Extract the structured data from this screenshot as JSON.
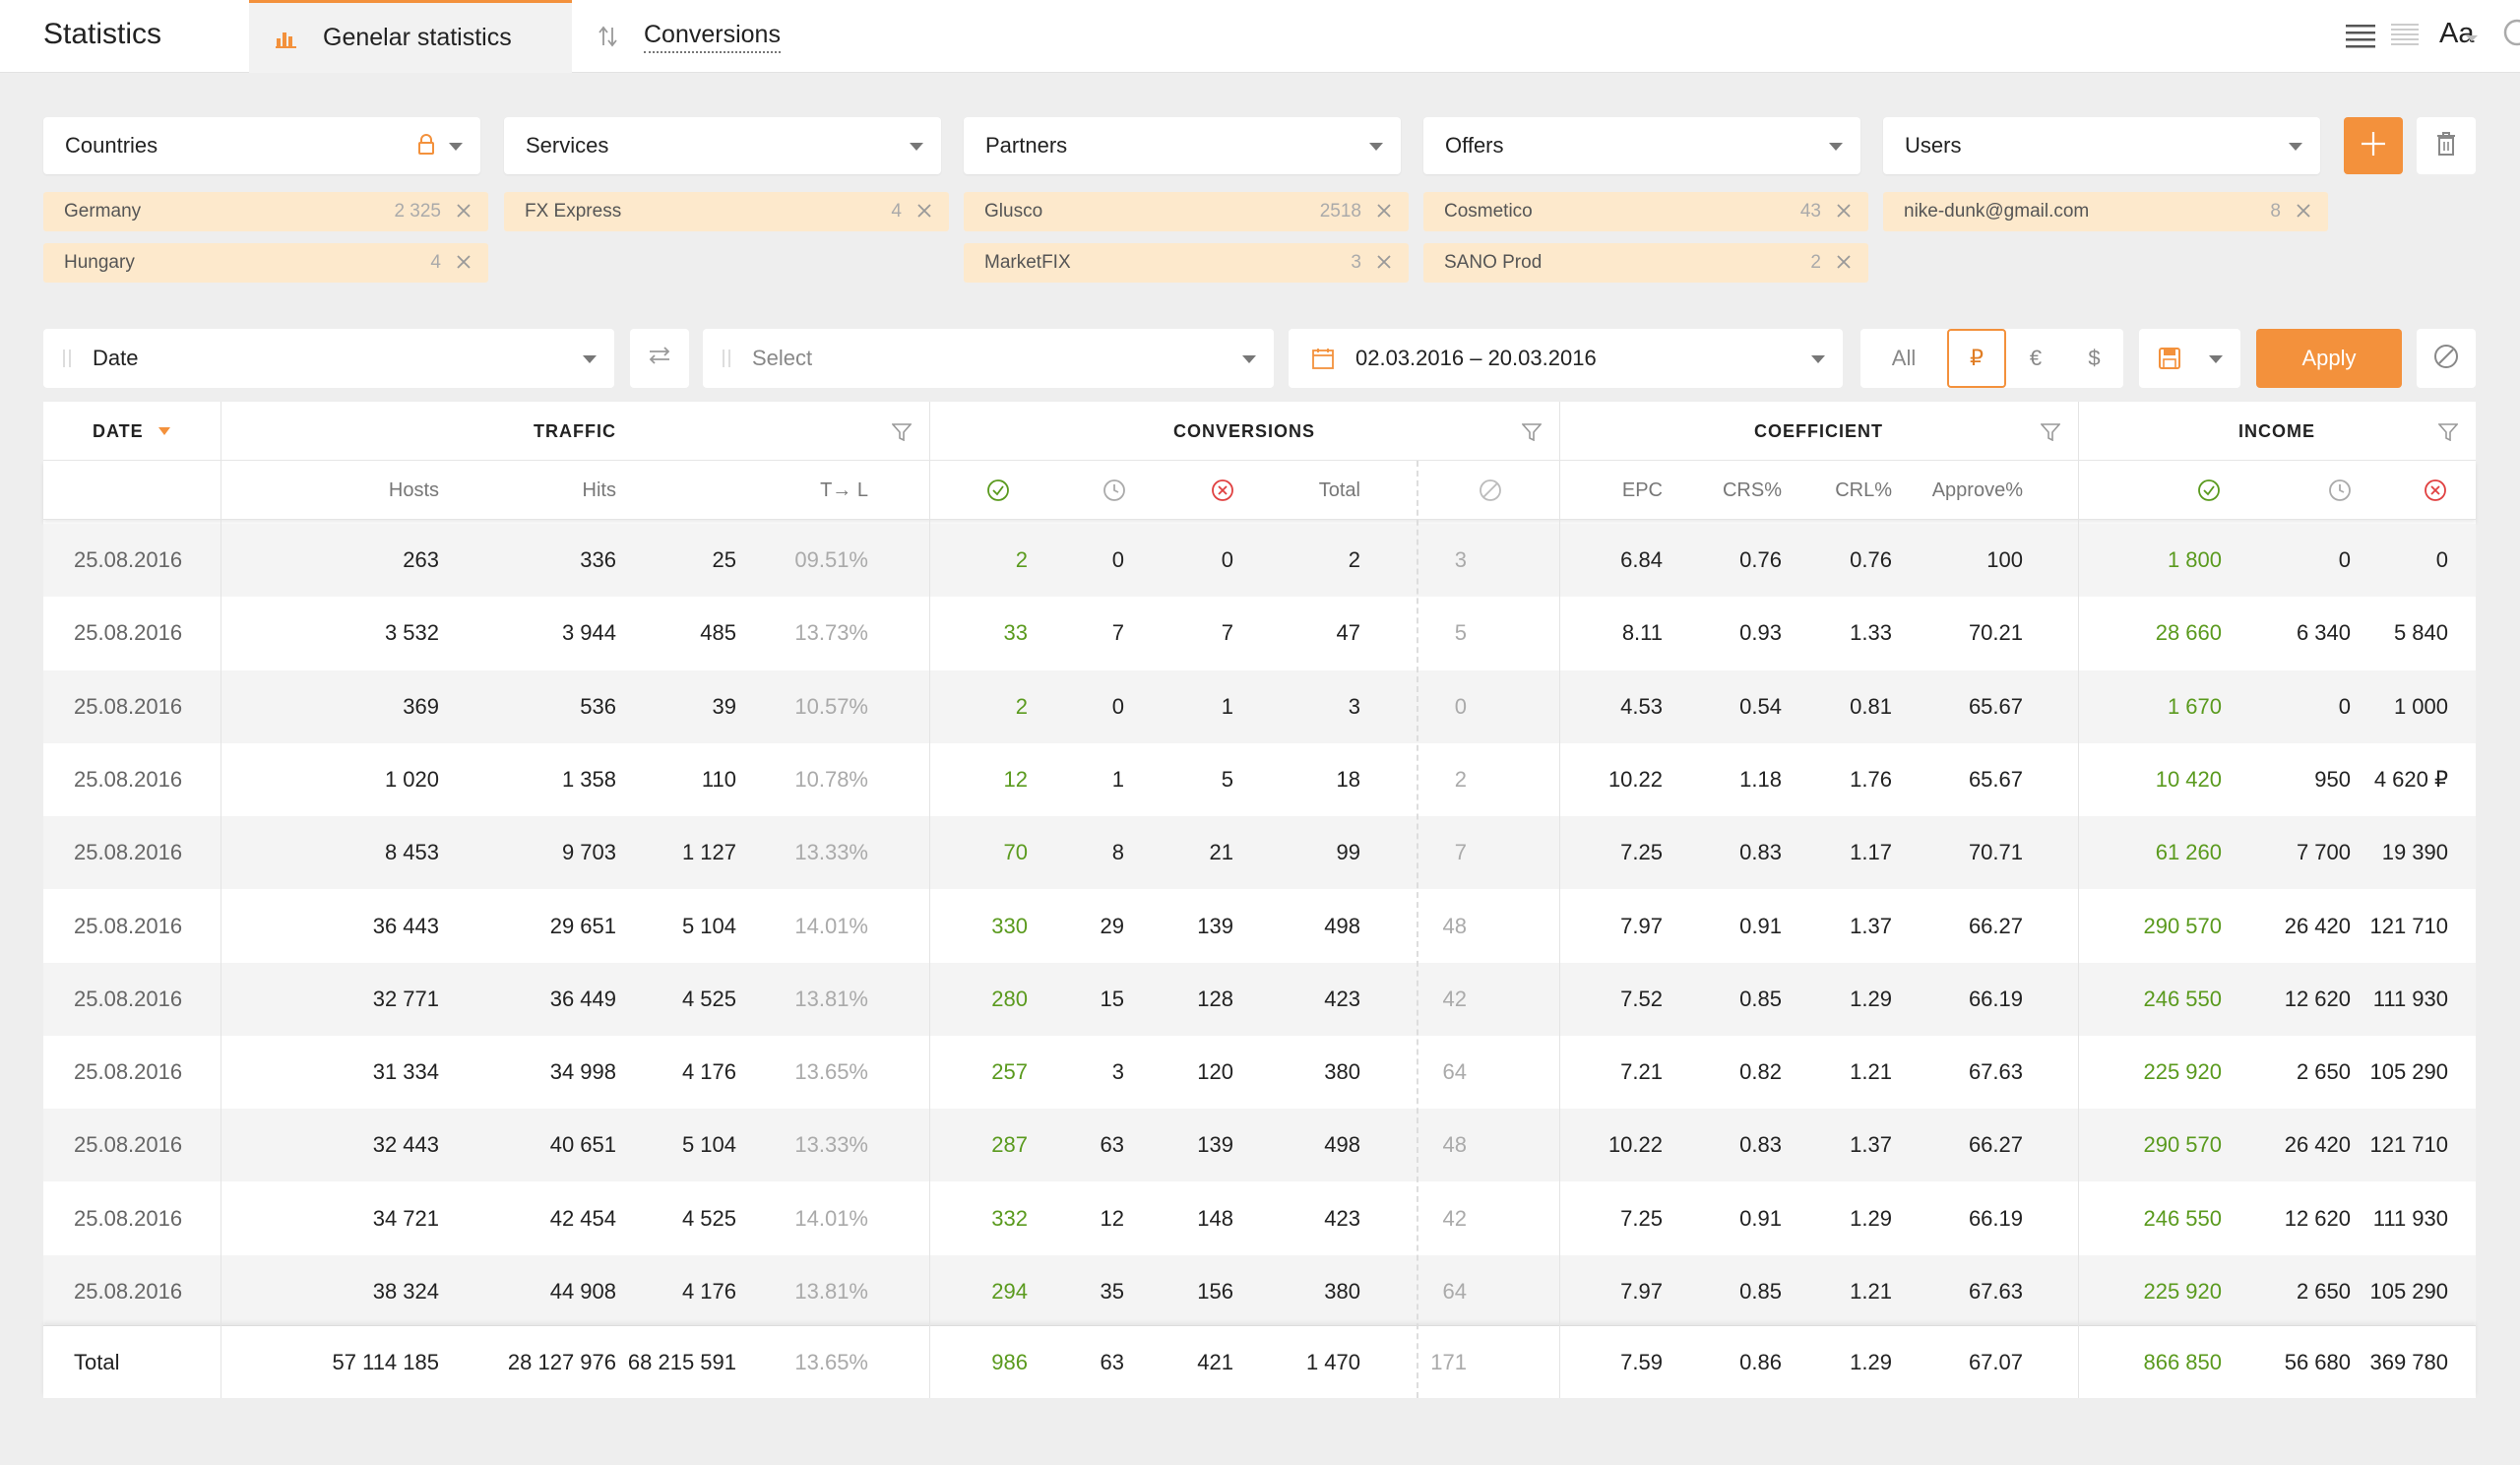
{
  "app_title": "Statistics",
  "tabs": [
    {
      "label": "Genelar statistics",
      "icon": "bar-chart-icon",
      "active": true
    },
    {
      "label": "Conversions",
      "icon": "sort-arrows-icon",
      "active": false
    }
  ],
  "toolbar_icons": {
    "list_view": "list-view-icon",
    "compact_view": "compact-list-icon",
    "font": "Aa",
    "search": "search-icon"
  },
  "filters": [
    {
      "label": "Countries",
      "locked": true,
      "tags": [
        {
          "name": "Germany",
          "count": "2 325"
        },
        {
          "name": "Hungary",
          "count": "4"
        }
      ]
    },
    {
      "label": "Services",
      "tags": [
        {
          "name": "FX Express",
          "count": "4"
        }
      ]
    },
    {
      "label": "Partners",
      "tags": [
        {
          "name": "Glusco",
          "count": "2518"
        },
        {
          "name": "MarketFIX",
          "count": "3"
        }
      ]
    },
    {
      "label": "Offers",
      "tags": [
        {
          "name": "Cosmetico",
          "count": "43"
        },
        {
          "name": "SANO Prod",
          "count": "2"
        }
      ]
    },
    {
      "label": "Users",
      "tags": [
        {
          "name": "nike-dunk@gmail.com",
          "count": "8"
        }
      ]
    }
  ],
  "group_by": {
    "value": "Date",
    "second_placeholder": "Select"
  },
  "date_range": "02.03.2016 – 20.03.2016",
  "currencies": [
    "All",
    "₽",
    "€",
    "$"
  ],
  "active_currency": "₽",
  "apply_label": "Apply",
  "accent_color": "#f3913c",
  "table": {
    "groups": {
      "date": "DATE",
      "traffic": "TRAFFIC",
      "conversions": "CONVERSIONS",
      "coefficient": "COEFFICIENT",
      "income": "INCOME"
    },
    "subheaders": {
      "hosts": "Hosts",
      "hits": "Hits",
      "tl": "T→ L",
      "total": "Total",
      "epc": "EPC",
      "crs": "CRS%",
      "crl": "CRL%",
      "approve": "Approve%"
    },
    "rows": [
      {
        "date": "25.08.2016",
        "hosts": "263",
        "hits": "336",
        "tl": "25",
        "tlp": "09.51%",
        "c_ok": "2",
        "c_wait": "0",
        "c_rej": "0",
        "c_total": "2",
        "c_cancel": "3",
        "epc": "6.84",
        "crs": "0.76",
        "crl": "0.76",
        "approve": "100",
        "i_ok": "1 800",
        "i_wait": "0",
        "i_rej": "0"
      },
      {
        "date": "25.08.2016",
        "hosts": "3 532",
        "hits": "3 944",
        "tl": "485",
        "tlp": "13.73%",
        "c_ok": "33",
        "c_wait": "7",
        "c_rej": "7",
        "c_total": "47",
        "c_cancel": "5",
        "epc": "8.11",
        "crs": "0.93",
        "crl": "1.33",
        "approve": "70.21",
        "i_ok": "28 660",
        "i_wait": "6 340",
        "i_rej": "5 840"
      },
      {
        "date": "25.08.2016",
        "hosts": "369",
        "hits": "536",
        "tl": "39",
        "tlp": "10.57%",
        "c_ok": "2",
        "c_wait": "0",
        "c_rej": "1",
        "c_total": "3",
        "c_cancel": "0",
        "epc": "4.53",
        "crs": "0.54",
        "crl": "0.81",
        "approve": "65.67",
        "i_ok": "1 670",
        "i_wait": "0",
        "i_rej": "1 000"
      },
      {
        "date": "25.08.2016",
        "hosts": "1 020",
        "hits": "1 358",
        "tl": "110",
        "tlp": "10.78%",
        "c_ok": "12",
        "c_wait": "1",
        "c_rej": "5",
        "c_total": "18",
        "c_cancel": "2",
        "epc": "10.22",
        "crs": "1.18",
        "crl": "1.76",
        "approve": "65.67",
        "i_ok": "10 420",
        "i_wait": "950",
        "i_rej": "4 620 ₽"
      },
      {
        "date": "25.08.2016",
        "hosts": "8 453",
        "hits": "9 703",
        "tl": "1 127",
        "tlp": "13.33%",
        "c_ok": "70",
        "c_wait": "8",
        "c_rej": "21",
        "c_total": "99",
        "c_cancel": "7",
        "epc": "7.25",
        "crs": "0.83",
        "crl": "1.17",
        "approve": "70.71",
        "i_ok": "61 260",
        "i_wait": "7 700",
        "i_rej": "19 390"
      },
      {
        "date": "25.08.2016",
        "hosts": "36 443",
        "hits": "29 651",
        "tl": "5 104",
        "tlp": "14.01%",
        "c_ok": "330",
        "c_wait": "29",
        "c_rej": "139",
        "c_total": "498",
        "c_cancel": "48",
        "epc": "7.97",
        "crs": "0.91",
        "crl": "1.37",
        "approve": "66.27",
        "i_ok": "290 570",
        "i_wait": "26 420",
        "i_rej": "121 710"
      },
      {
        "date": "25.08.2016",
        "hosts": "32 771",
        "hits": "36 449",
        "tl": "4 525",
        "tlp": "13.81%",
        "c_ok": "280",
        "c_wait": "15",
        "c_rej": "128",
        "c_total": "423",
        "c_cancel": "42",
        "epc": "7.52",
        "crs": "0.85",
        "crl": "1.29",
        "approve": "66.19",
        "i_ok": "246 550",
        "i_wait": "12 620",
        "i_rej": "111 930"
      },
      {
        "date": "25.08.2016",
        "hosts": "31 334",
        "hits": "34 998",
        "tl": "4 176",
        "tlp": "13.65%",
        "c_ok": "257",
        "c_wait": "3",
        "c_rej": "120",
        "c_total": "380",
        "c_cancel": "64",
        "epc": "7.21",
        "crs": "0.82",
        "crl": "1.21",
        "approve": "67.63",
        "i_ok": "225 920",
        "i_wait": "2 650",
        "i_rej": "105 290"
      },
      {
        "date": "25.08.2016",
        "hosts": "32 443",
        "hits": "40 651",
        "tl": "5 104",
        "tlp": "13.33%",
        "c_ok": "287",
        "c_wait": "63",
        "c_rej": "139",
        "c_total": "498",
        "c_cancel": "48",
        "epc": "10.22",
        "crs": "0.83",
        "crl": "1.37",
        "approve": "66.27",
        "i_ok": "290 570",
        "i_wait": "26 420",
        "i_rej": "121 710"
      },
      {
        "date": "25.08.2016",
        "hosts": "34 721",
        "hits": "42 454",
        "tl": "4 525",
        "tlp": "14.01%",
        "c_ok": "332",
        "c_wait": "12",
        "c_rej": "148",
        "c_total": "423",
        "c_cancel": "42",
        "epc": "7.25",
        "crs": "0.91",
        "crl": "1.29",
        "approve": "66.19",
        "i_ok": "246 550",
        "i_wait": "12 620",
        "i_rej": "111 930"
      },
      {
        "date": "25.08.2016",
        "hosts": "38 324",
        "hits": "44 908",
        "tl": "4 176",
        "tlp": "13.81%",
        "c_ok": "294",
        "c_wait": "35",
        "c_rej": "156",
        "c_total": "380",
        "c_cancel": "64",
        "epc": "7.97",
        "crs": "0.85",
        "crl": "1.21",
        "approve": "67.63",
        "i_ok": "225 920",
        "i_wait": "2 650",
        "i_rej": "105 290"
      }
    ],
    "total": {
      "date": "Total",
      "hosts": "57 114 185",
      "hits": "28 127 976",
      "tl": "68 215 591",
      "tlp": "13.65%",
      "c_ok": "986",
      "c_wait": "63",
      "c_rej": "421",
      "c_total": "1 470",
      "c_cancel": "171",
      "epc": "7.59",
      "crs": "0.86",
      "crl": "1.29",
      "approve": "67.07",
      "i_ok": "866 850",
      "i_wait": "56 680",
      "i_rej": "369 780"
    }
  }
}
